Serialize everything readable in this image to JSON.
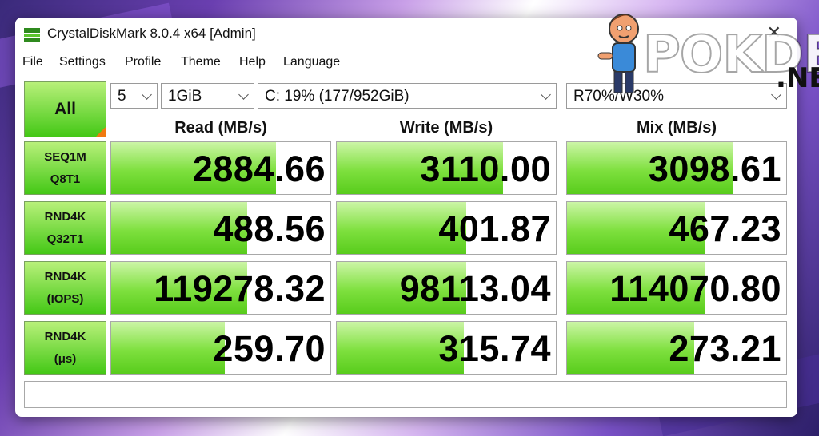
{
  "window": {
    "title": "CrystalDiskMark 8.0.4 x64 [Admin]"
  },
  "menu": [
    "File",
    "Settings",
    "Profile",
    "Theme",
    "Help",
    "Language"
  ],
  "controls": {
    "all_label": "All",
    "count": "5",
    "size": "1GiB",
    "drive": "C: 19% (177/952GiB)",
    "mix": "R70%/W30%"
  },
  "columns": {
    "read": "Read (MB/s)",
    "write": "Write (MB/s)",
    "mix": "Mix (MB/s)"
  },
  "rows": [
    {
      "line1": "SEQ1M",
      "line2": "Q8T1",
      "read": "2884.66",
      "write": "3110.00",
      "mix": "3098.61",
      "read_fill": 0.75,
      "write_fill": 0.76,
      "mix_fill": 0.76
    },
    {
      "line1": "RND4K",
      "line2": "Q32T1",
      "read": "488.56",
      "write": "401.87",
      "mix": "467.23",
      "read_fill": 0.62,
      "write_fill": 0.59,
      "mix_fill": 0.63
    },
    {
      "line1": "RND4K",
      "line2": "(IOPS)",
      "read": "119278.32",
      "write": "98113.04",
      "mix": "114070.80",
      "read_fill": 0.62,
      "write_fill": 0.59,
      "mix_fill": 0.63
    },
    {
      "line1": "RND4K",
      "line2": "(μs)",
      "read": "259.70",
      "write": "315.74",
      "mix": "273.21",
      "read_fill": 0.52,
      "write_fill": 0.58,
      "mix_fill": 0.58
    }
  ],
  "watermark": {
    "text": "POKDE",
    "suffix": ".NET"
  },
  "colors": {
    "bar_green": "#58cc1c",
    "label_green": "#44c816",
    "corner_orange": "#f07a10"
  }
}
